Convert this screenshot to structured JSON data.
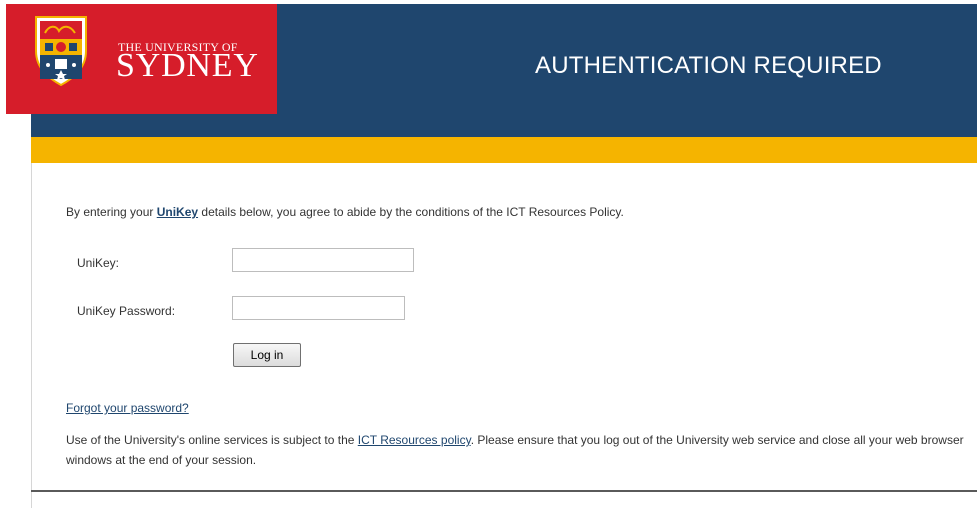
{
  "header": {
    "logo": {
      "small_text": "THE UNIVERSITY OF",
      "big_text": "SYDNEY"
    },
    "title": "AUTHENTICATION REQUIRED"
  },
  "intro": {
    "prefix": "By entering your ",
    "link_text": "UniKey",
    "suffix": " details below, you agree to abide by the conditions of the ICT Resources Policy."
  },
  "form": {
    "unikey_label": "UniKey:",
    "unikey_value": "",
    "password_label": "UniKey Password:",
    "password_value": "",
    "login_button": "Log in"
  },
  "links": {
    "forgot_password": "Forgot your password?"
  },
  "policy": {
    "prefix": "Use of the University's online services is subject to the ",
    "link_text": "ICT Resources policy",
    "suffix": ". Please ensure that you log out of the University web service and close all your web browser windows at the end of your session."
  },
  "colors": {
    "brand_red": "#d61d2a",
    "brand_navy": "#1f466e",
    "brand_gold": "#f5b400"
  },
  "icons": {
    "crest": "university-crest-icon"
  }
}
